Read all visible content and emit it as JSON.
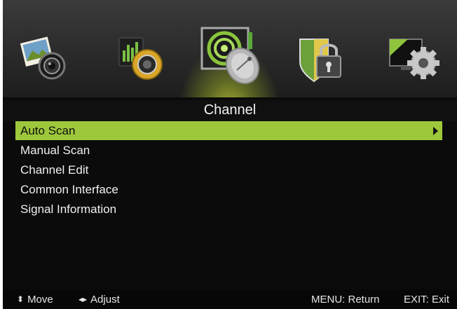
{
  "menu_tabs": [
    {
      "name": "picture-icon"
    },
    {
      "name": "sound-icon"
    },
    {
      "name": "channel-icon"
    },
    {
      "name": "lock-icon"
    },
    {
      "name": "setup-icon"
    }
  ],
  "page": {
    "title": "Channel"
  },
  "menu": {
    "items": [
      {
        "label": "Auto Scan"
      },
      {
        "label": "Manual Scan"
      },
      {
        "label": "Channel Edit"
      },
      {
        "label": "Common Interface"
      },
      {
        "label": "Signal Information"
      }
    ]
  },
  "footer": {
    "move_glyph": "⬍",
    "move_label": "Move",
    "adjust_glyph": "◂▸",
    "adjust_label": "Adjust",
    "return_label": "MENU: Return",
    "exit_label": "EXIT: Exit"
  },
  "colors": {
    "highlight": "#9ec83c",
    "background": "#0b0b0b",
    "text": "#f0f0f0"
  }
}
